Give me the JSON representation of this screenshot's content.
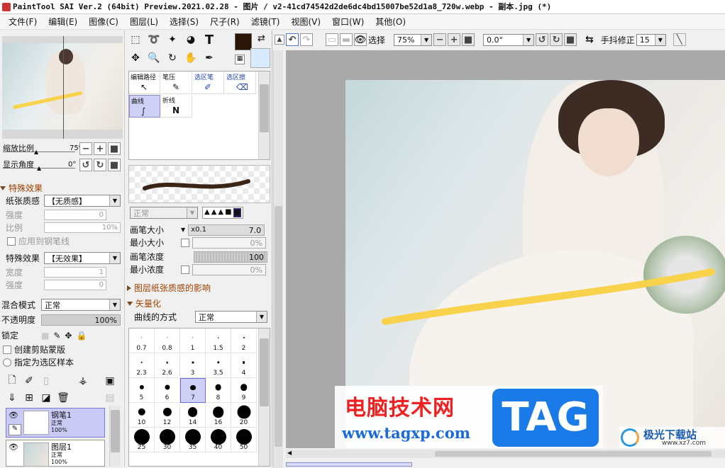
{
  "window": {
    "title": "PaintTool SAI Ver.2 (64bit) Preview.2021.02.28 - 图片 / v2-41cd74542d2de6dc4bd15007be52d1a8_720w.webp - 副本.jpg (*)"
  },
  "menu": [
    "文件(F)",
    "编辑(E)",
    "图像(C)",
    "图层(L)",
    "选择(S)",
    "尺子(R)",
    "滤镜(T)",
    "视图(V)",
    "窗口(W)",
    "其他(O)"
  ],
  "navigator": {
    "zoom_label": "缩放比例",
    "zoom_value": "75%",
    "angle_label": "显示角度",
    "angle_value": "0°"
  },
  "effects": {
    "header": "特殊效果",
    "paper_label": "纸张质感",
    "paper_value": "【无质感】",
    "strength_label": "强度",
    "strength_value": "0",
    "scale_label": "比例",
    "scale_value": "10%",
    "apply_pen_label": "应用到钢笔线",
    "effect_label": "特殊效果",
    "effect_value": "【无效果】",
    "width_label": "宽度",
    "width_value": "1",
    "strength2_label": "强度",
    "strength2_value": "0"
  },
  "layer_props": {
    "blend_label": "混合模式",
    "blend_value": "正常",
    "opacity_label": "不透明度",
    "opacity_value": "100%",
    "opacity_fraction": 1.0,
    "lock_label": "锁定",
    "clip_label": "创建剪贴蒙版",
    "select_label": "指定为选区样本"
  },
  "layers": [
    {
      "name": "钢笔1",
      "mode": "正常",
      "opacity": "100%"
    },
    {
      "name": "图层1",
      "mode": "正常",
      "opacity": "100%"
    }
  ],
  "pen_tools": [
    {
      "label": "编辑路径",
      "icon": "↖"
    },
    {
      "label": "笔压",
      "icon": "✎"
    },
    {
      "label": "选区笔",
      "icon": "✐"
    },
    {
      "label": "选区擦",
      "icon": "⌫"
    },
    {
      "label": "曲线",
      "icon": "∫"
    },
    {
      "label": "折线",
      "icon": "N"
    }
  ],
  "brush": {
    "mode_value": "正常",
    "size_label": "画笔大小",
    "size_mult": "x0.1",
    "size_value": "7.0",
    "min_size_label": "最小大小",
    "min_size_value": "0%",
    "density_label": "画笔浓度",
    "density_value": "100",
    "density_fraction": 1.0,
    "min_density_label": "最小浓度",
    "min_density_value": "0%",
    "paper_effect_label": "图层纸张质感的影响",
    "vector_label": "矢量化",
    "curve_label": "曲线的方式",
    "curve_value": "正常"
  },
  "brush_sizes": [
    "0.7",
    "0.8",
    "1",
    "1.5",
    "2",
    "2.3",
    "2.6",
    "3",
    "3.5",
    "4",
    "5",
    "6",
    "7",
    "8",
    "9",
    "10",
    "12",
    "14",
    "16",
    "20",
    "25",
    "30",
    "35",
    "40",
    "50"
  ],
  "toolbar": {
    "select_label": "选择",
    "zoom_value": "75%",
    "angle_value": "0.0°",
    "stabilizer_label": "手抖修正",
    "stabilizer_value": "15"
  },
  "colors": {
    "main": "#2a1608",
    "sub": "#d9ecff",
    "stroke": "#f7d24a"
  },
  "watermark": {
    "text1": "电脑技术网",
    "tag": "TAG",
    "url": "www.tagxp.com",
    "logo_text": "极光下载站",
    "logo_url": "www.xz7.com"
  }
}
